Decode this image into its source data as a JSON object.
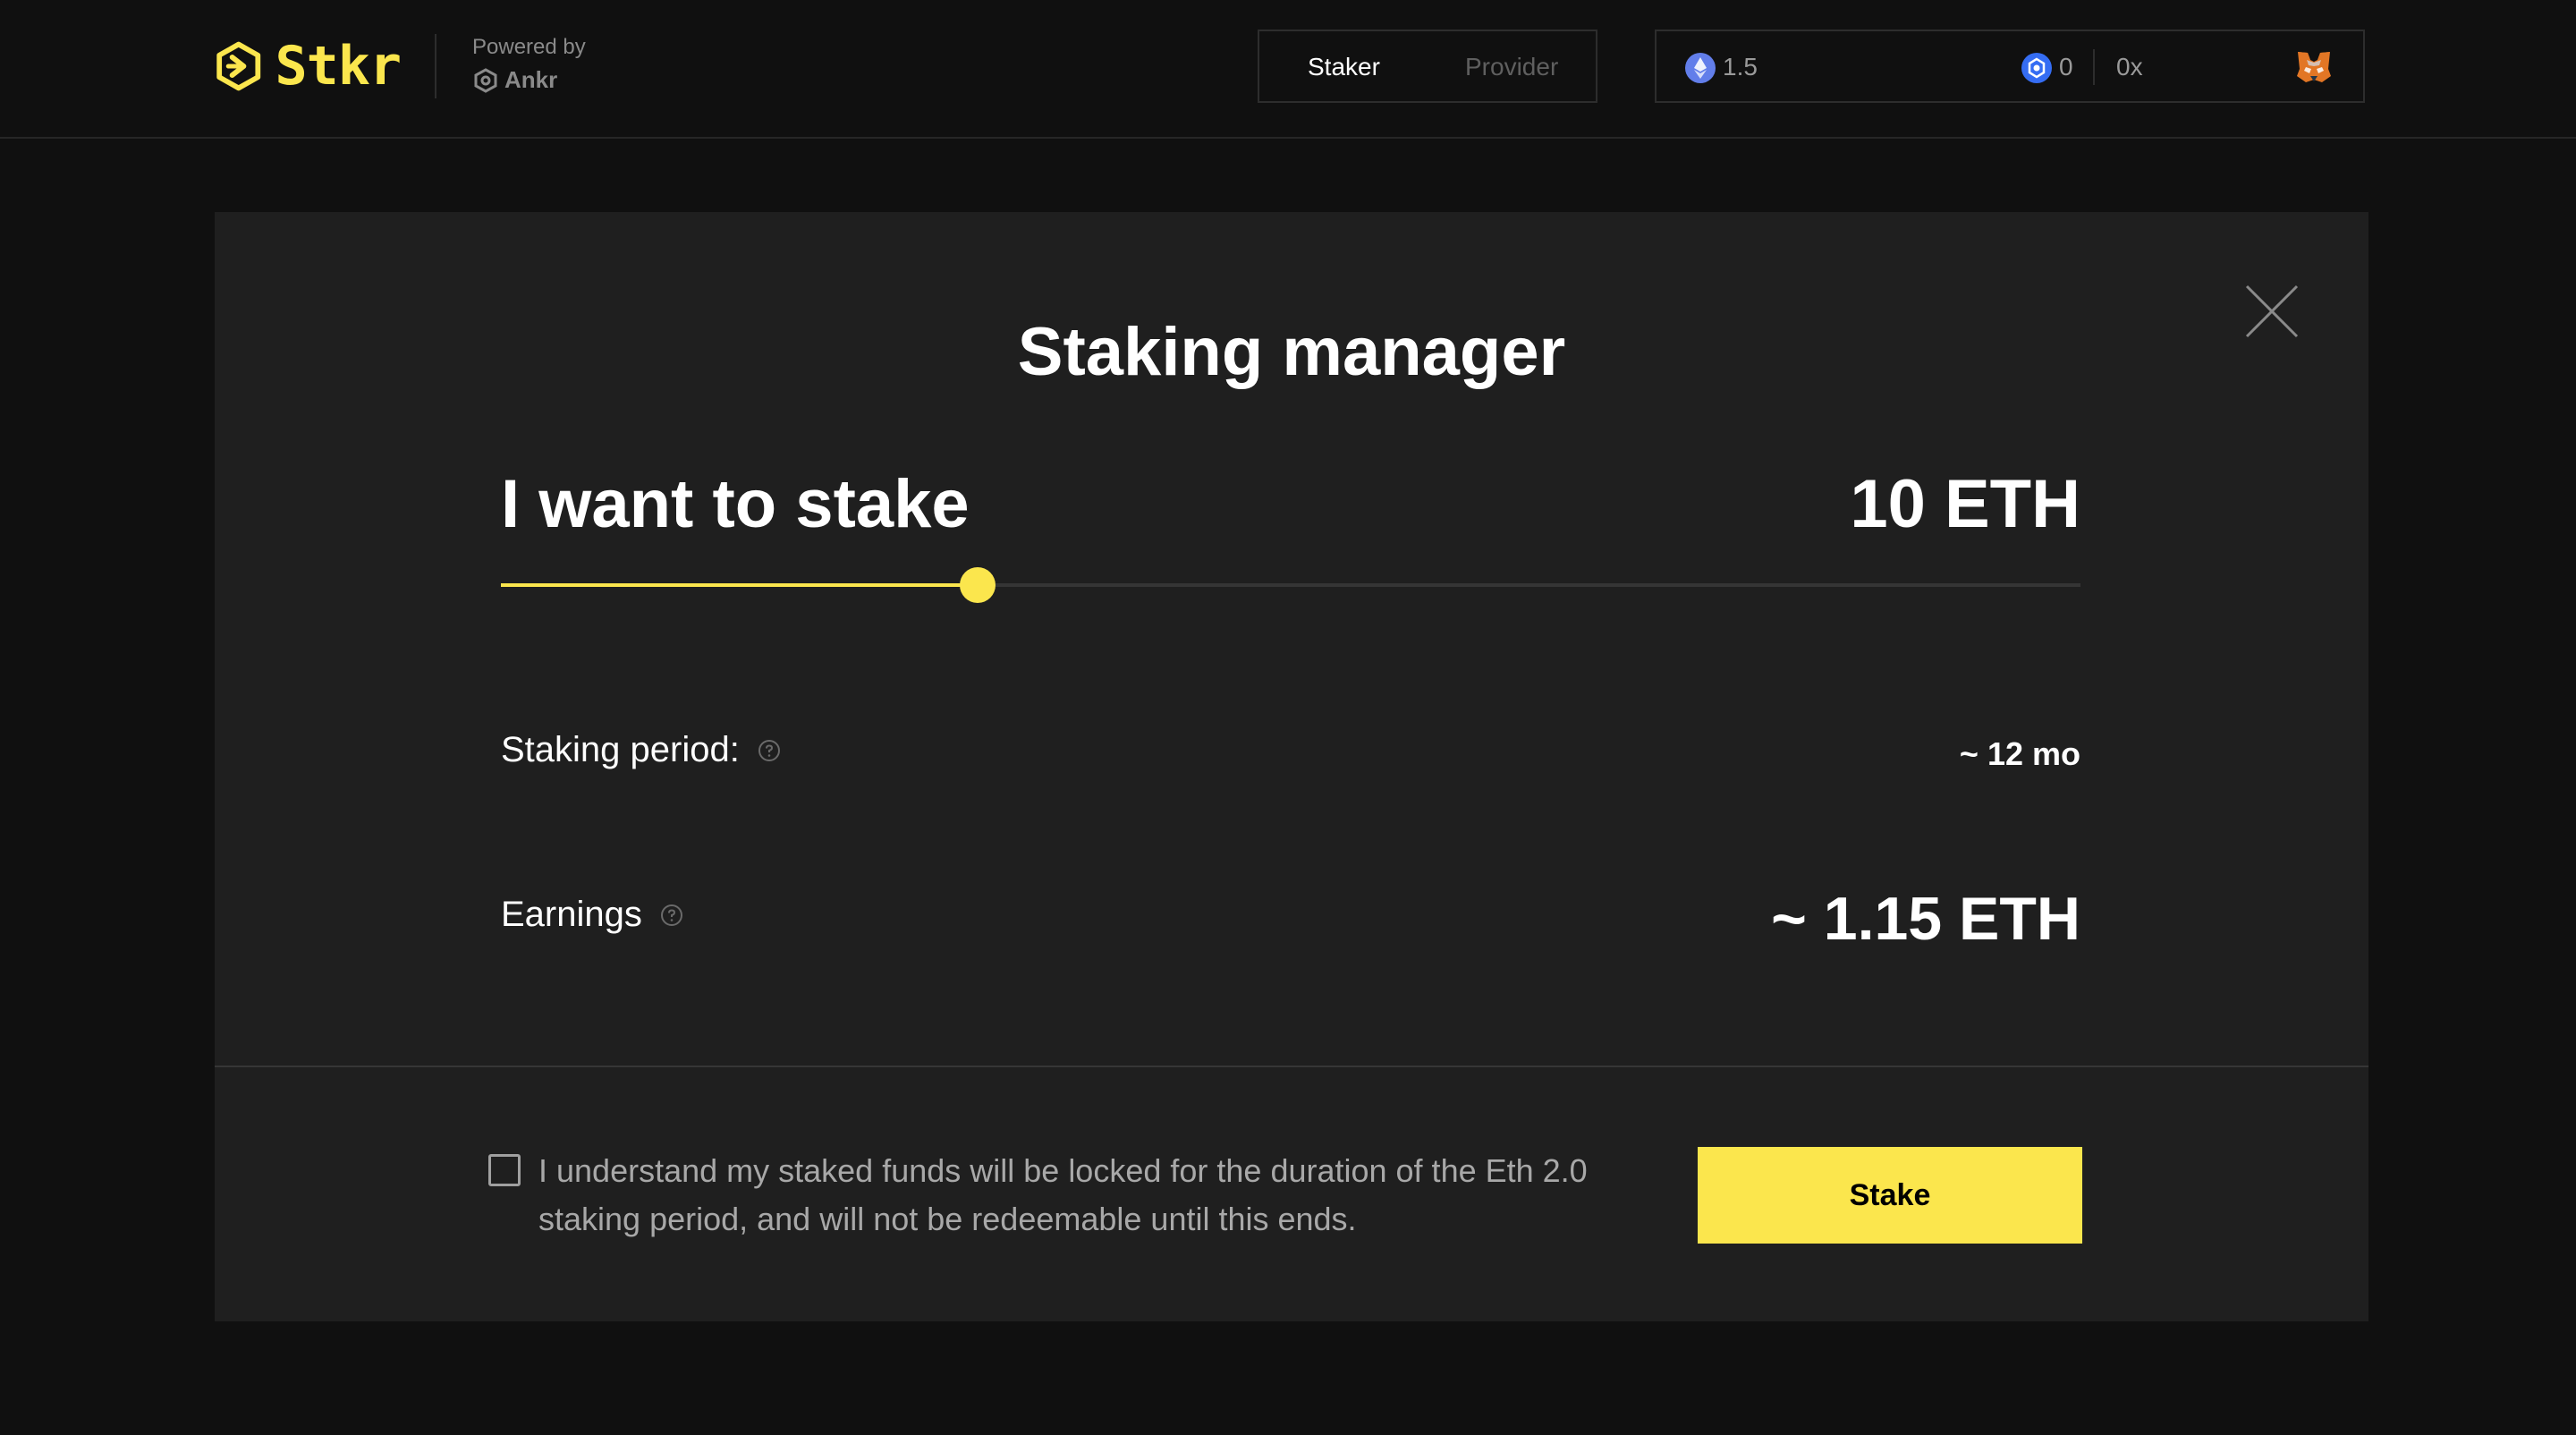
{
  "header": {
    "brand_name": "Stkr",
    "powered_by_label": "Powered by",
    "partner_name": "Ankr",
    "role_tabs": [
      {
        "label": "Staker",
        "active": true
      },
      {
        "label": "Provider",
        "active": false
      }
    ],
    "wallet": {
      "eth_balance": "1.5",
      "ankr_balance": "0",
      "address": "0x",
      "wallet_icon": "metamask-fox-icon"
    }
  },
  "modal": {
    "title": "Staking manager",
    "stake_label": "I want to stake",
    "stake_amount": "10 ETH",
    "slider_fraction": 0.302,
    "staking_period_label": "Staking period:",
    "staking_period_value": "~ 12 mo",
    "earnings_label": "Earnings",
    "earnings_value": "~ 1.15 ETH",
    "consent_checked": false,
    "consent_text": "I understand my staked funds will be locked for the duration of the Eth 2.0 staking period, and will not be redeemable until this ends.",
    "stake_button_label": "Stake"
  },
  "colors": {
    "accent": "#fbe64d",
    "background": "#101010",
    "modal_background": "#1f1f1f",
    "muted_text": "#a8a8a8",
    "eth_icon": "#627eea",
    "ankr_icon": "#356df3"
  }
}
